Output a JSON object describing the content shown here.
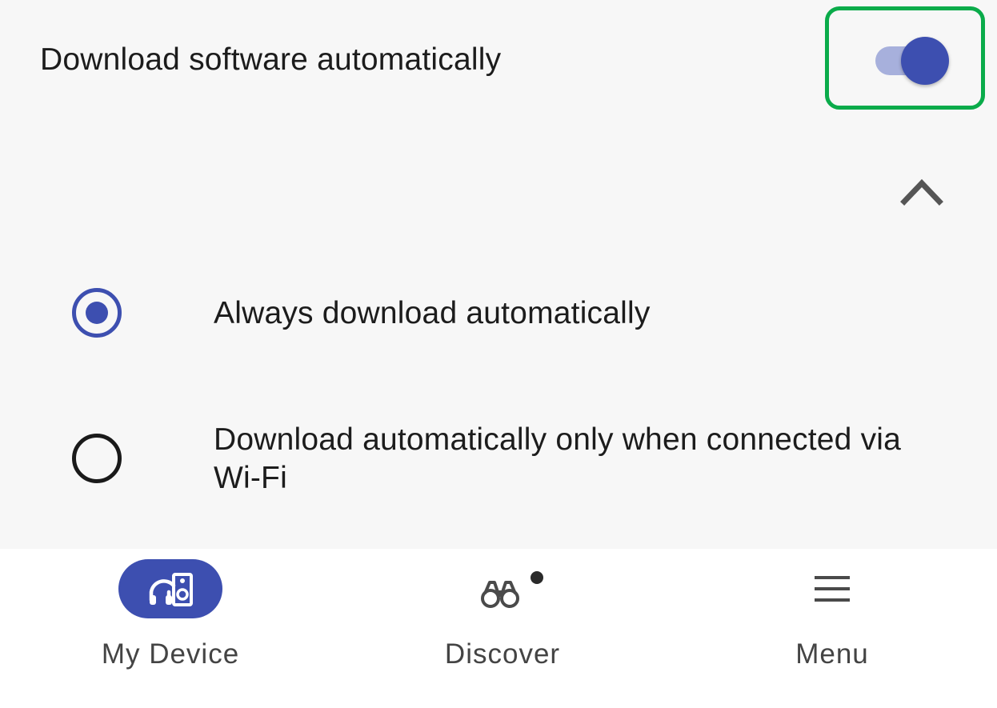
{
  "setting": {
    "title": "Download software automatically",
    "toggle_on": true
  },
  "options": [
    {
      "label": "Always download automatically",
      "selected": true
    },
    {
      "label": "Download automatically only when connected via Wi-Fi",
      "selected": false
    }
  ],
  "bottom_nav": {
    "items": [
      {
        "label": "My Device",
        "icon": "headphones-speaker-icon",
        "active": true
      },
      {
        "label": "Discover",
        "icon": "binoculars-icon",
        "active": false,
        "badge": true
      },
      {
        "label": "Menu",
        "icon": "hamburger-menu-icon",
        "active": false
      }
    ]
  },
  "colors": {
    "accent": "#3d4fb0",
    "track": "#a7b0dc",
    "highlight": "#0aab4a",
    "background": "#f7f7f7",
    "nav_background": "#ffffff",
    "text": "#1c1c1c",
    "nav_text": "#444444"
  }
}
